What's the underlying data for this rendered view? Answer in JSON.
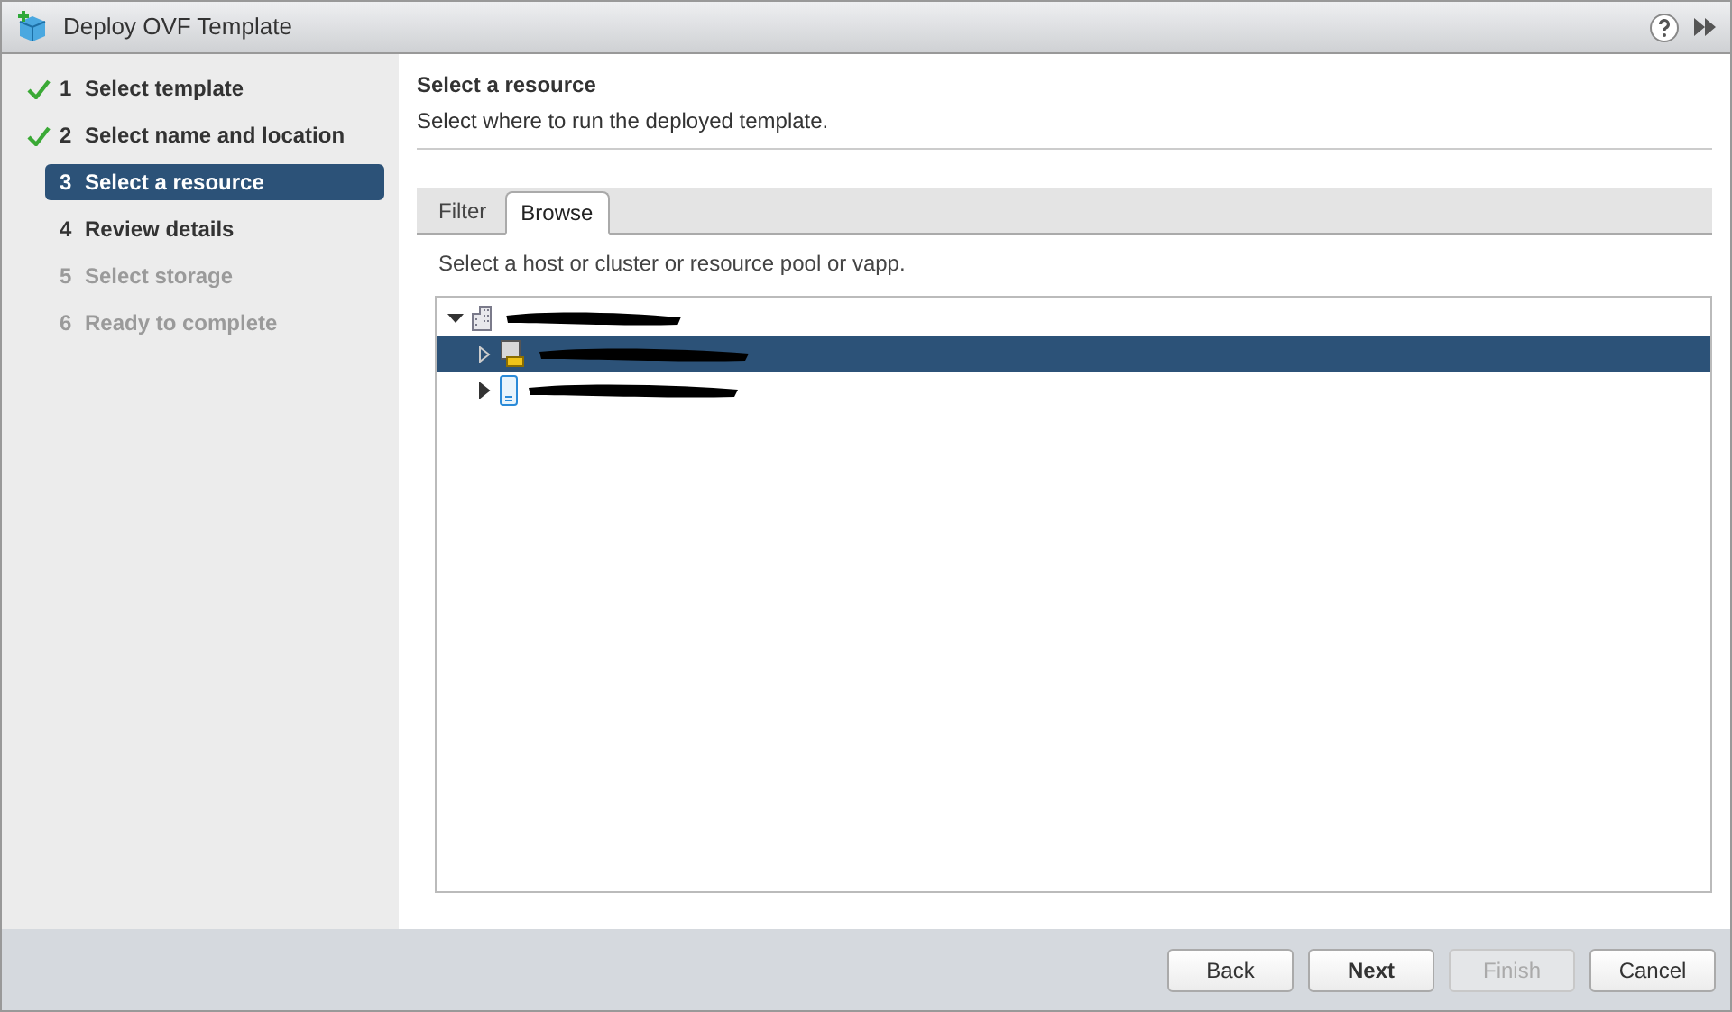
{
  "window": {
    "title": "Deploy OVF Template"
  },
  "steps": [
    {
      "number": "1",
      "label": "Select template",
      "completed": true,
      "disabled": false,
      "selected": false
    },
    {
      "number": "2",
      "label": "Select name and location",
      "completed": true,
      "disabled": false,
      "selected": false
    },
    {
      "number": "3",
      "label": "Select a resource",
      "completed": false,
      "disabled": false,
      "selected": true
    },
    {
      "number": "4",
      "label": "Review details",
      "completed": false,
      "disabled": false,
      "selected": false
    },
    {
      "number": "5",
      "label": "Select storage",
      "completed": false,
      "disabled": true,
      "selected": false
    },
    {
      "number": "6",
      "label": "Ready to complete",
      "completed": false,
      "disabled": true,
      "selected": false
    }
  ],
  "page": {
    "title": "Select a resource",
    "subtitle": "Select where to run the deployed template."
  },
  "tabs": [
    {
      "label": "Filter",
      "selected": false
    },
    {
      "label": "Browse",
      "selected": true
    }
  ],
  "instruction": "Select a host or cluster or resource pool or vapp.",
  "tree": [
    {
      "kind": "datacenter",
      "expanded": true,
      "selected": false,
      "children": [
        {
          "kind": "cluster",
          "expanded": false,
          "selected": true
        },
        {
          "kind": "host",
          "expanded": false,
          "selected": false
        }
      ]
    }
  ],
  "buttons": [
    {
      "label": "Back",
      "primary": false,
      "disabled": false
    },
    {
      "label": "Next",
      "primary": true,
      "disabled": false
    },
    {
      "label": "Finish",
      "primary": false,
      "disabled": true
    },
    {
      "label": "Cancel",
      "primary": false,
      "disabled": false
    }
  ]
}
